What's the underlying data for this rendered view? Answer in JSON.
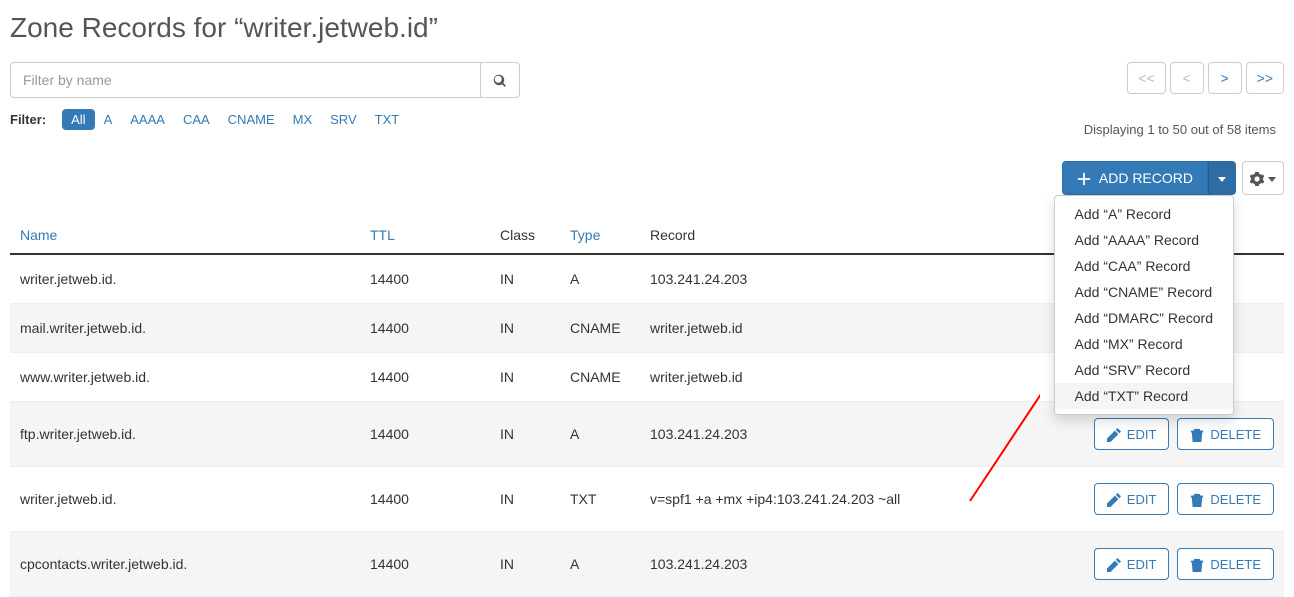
{
  "page": {
    "title": "Zone Records for “writer.jetweb.id”"
  },
  "filter": {
    "placeholder": "Filter by name",
    "label": "Filter:",
    "chips": [
      "All",
      "A",
      "AAAA",
      "CAA",
      "CNAME",
      "MX",
      "SRV",
      "TXT"
    ],
    "active": "All"
  },
  "pager": {
    "first": "<<",
    "prev": "<",
    "next": ">",
    "last": ">>",
    "status": "Displaying 1 to 50 out of 58 items"
  },
  "actions": {
    "add_label": "ADD RECORD",
    "dropdown": [
      "Add “A” Record",
      "Add “AAAA” Record",
      "Add “CAA” Record",
      "Add “CNAME” Record",
      "Add “DMARC” Record",
      "Add “MX” Record",
      "Add “SRV” Record",
      "Add “TXT” Record"
    ]
  },
  "table": {
    "headers": {
      "name": "Name",
      "ttl": "TTL",
      "class": "Class",
      "type": "Type",
      "record": "Record"
    },
    "edit_label": "EDIT",
    "delete_label": "DELETE",
    "rows": [
      {
        "name": "writer.jetweb.id.",
        "ttl": "14400",
        "class": "IN",
        "type": "A",
        "record": "103.241.24.203"
      },
      {
        "name": "mail.writer.jetweb.id.",
        "ttl": "14400",
        "class": "IN",
        "type": "CNAME",
        "record": "writer.jetweb.id"
      },
      {
        "name": "www.writer.jetweb.id.",
        "ttl": "14400",
        "class": "IN",
        "type": "CNAME",
        "record": "writer.jetweb.id"
      },
      {
        "name": "ftp.writer.jetweb.id.",
        "ttl": "14400",
        "class": "IN",
        "type": "A",
        "record": "103.241.24.203"
      },
      {
        "name": "writer.jetweb.id.",
        "ttl": "14400",
        "class": "IN",
        "type": "TXT",
        "record": "v=spf1 +a +mx +ip4:103.241.24.203 ~all"
      },
      {
        "name": "cpcontacts.writer.jetweb.id.",
        "ttl": "14400",
        "class": "IN",
        "type": "A",
        "record": "103.241.24.203"
      }
    ]
  }
}
